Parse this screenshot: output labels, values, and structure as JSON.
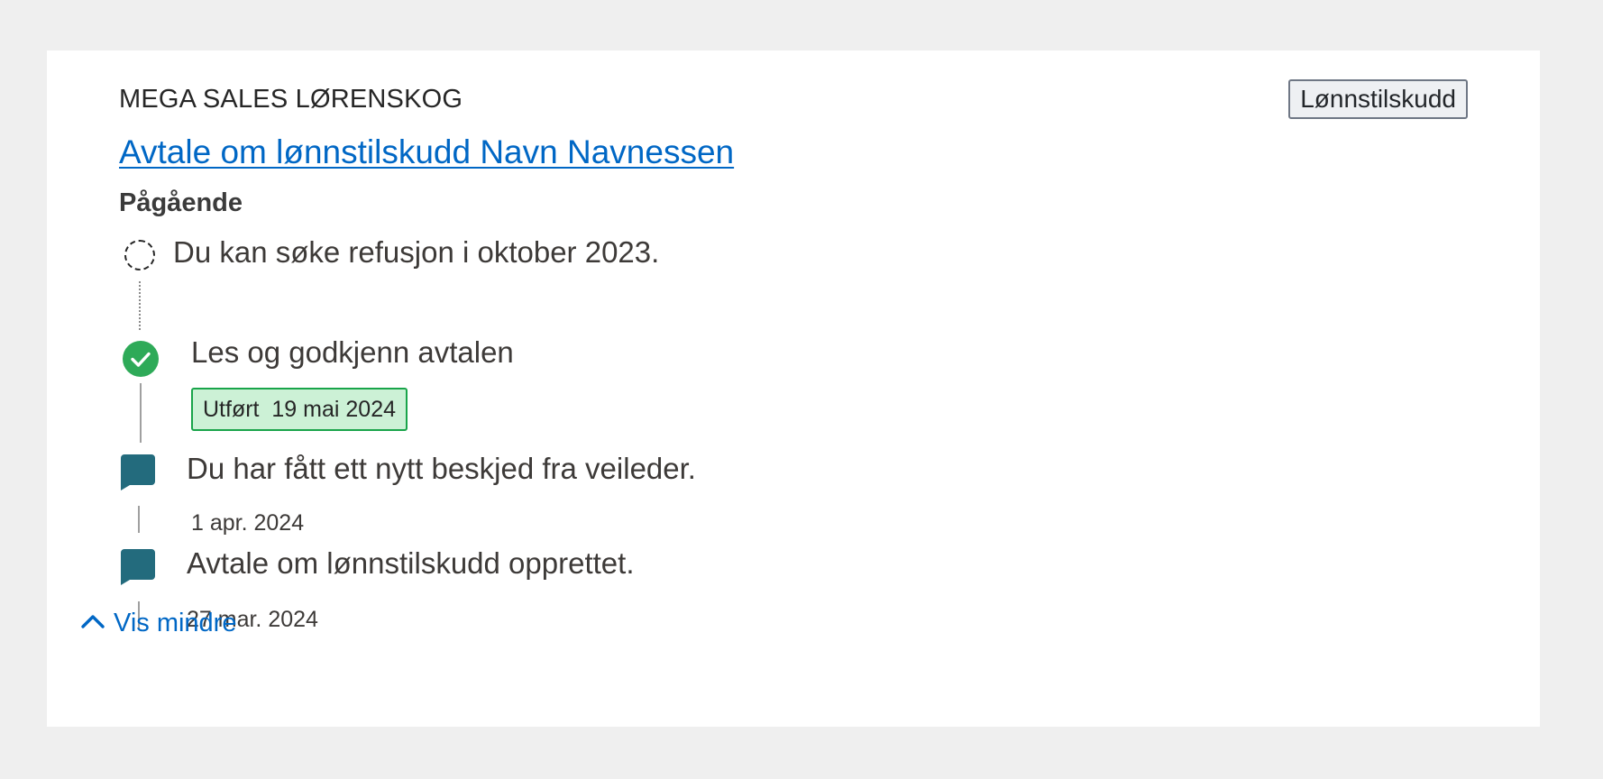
{
  "card": {
    "organization": "MEGA SALES LØRENSKOG",
    "tag": "Lønnstilskudd",
    "title": "Avtale om lønnstilskudd Navn Navnessen",
    "status": "Pågående"
  },
  "timeline": {
    "upcoming": {
      "text": "Du kan søke refusjon i oktober 2023."
    },
    "task": {
      "text": "Les og godkjenn avtalen",
      "badge_label": "Utført",
      "badge_date": "19 mai 2024"
    },
    "message1": {
      "text": "Du har fått ett nytt beskjed fra veileder.",
      "date": "1 apr. 2024"
    },
    "message2": {
      "text": "Avtale om lønnstilskudd opprettet.",
      "date": "27 mar. 2024"
    }
  },
  "toggle": {
    "label": "Vis mindre"
  },
  "colors": {
    "link": "#0067c5",
    "success": "#2eaa58",
    "message_icon": "#236b7d",
    "badge_bg": "#ccf1d6"
  },
  "icons": {
    "upcoming": "dashed-circle-icon",
    "done": "check-circle-icon",
    "message": "chat-bubble-icon",
    "toggle": "chevron-up-icon"
  }
}
